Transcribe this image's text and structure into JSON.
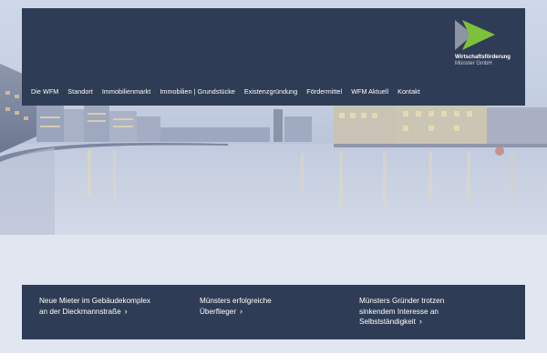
{
  "brand": {
    "name": "Wirtschaftsförderung",
    "sub": "Münster GmbH",
    "colors": {
      "navy": "#2f3c55",
      "green": "#7dc13a",
      "grey": "#8d95a3"
    }
  },
  "nav": {
    "items": [
      {
        "label": "Die WFM"
      },
      {
        "label": "Standort"
      },
      {
        "label": "Immobilienmarkt"
      },
      {
        "label": "Immobilien | Grundstücke"
      },
      {
        "label": "Existenzgründung"
      },
      {
        "label": "Fördermittel"
      },
      {
        "label": "WFM Aktuell"
      },
      {
        "label": "Kontakt"
      }
    ]
  },
  "teasers": [
    {
      "line1": "Neue Mieter im Gebäudekomplex",
      "line2": "an der Dieckmannstraße",
      "line3": ""
    },
    {
      "line1": "Münsters erfolgreiche",
      "line2": "Überflieger",
      "line3": ""
    },
    {
      "line1": "Münsters Gründer trotzen",
      "line2": "sinkendem Interesse an",
      "line3": "Selbstständigkeit"
    }
  ],
  "icons": {
    "chevron": "chevron-right-icon"
  }
}
